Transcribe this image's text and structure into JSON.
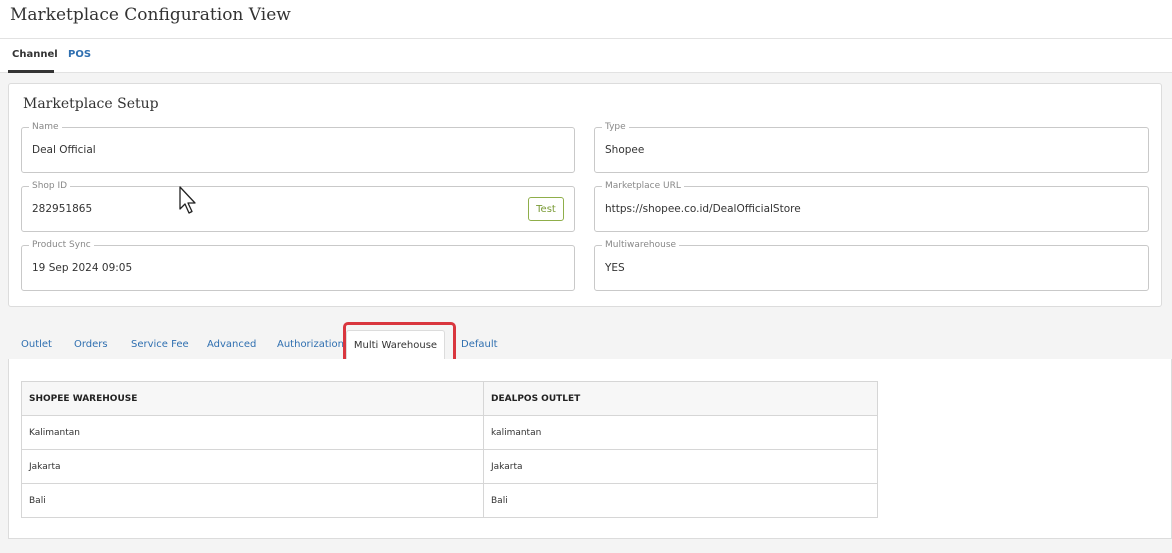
{
  "page": {
    "title": "Marketplace Configuration View"
  },
  "top_tabs": [
    {
      "label": "Channel",
      "active": true
    },
    {
      "label": "POS",
      "active": false
    }
  ],
  "setup": {
    "title": "Marketplace Setup",
    "fields": {
      "name": {
        "label": "Name",
        "value": "Deal Official"
      },
      "type": {
        "label": "Type",
        "value": "Shopee"
      },
      "shop_id": {
        "label": "Shop ID",
        "value": "282951865"
      },
      "marketplace_url": {
        "label": "Marketplace URL",
        "value": "https://shopee.co.id/DealOfficialStore"
      },
      "product_sync": {
        "label": "Product Sync",
        "value": "19 Sep 2024 09:05"
      },
      "multiwarehouse": {
        "label": "Multiwarehouse",
        "value": "YES"
      }
    },
    "test_button_label": "Test"
  },
  "sub_tabs": [
    {
      "label": "Outlet"
    },
    {
      "label": "Orders"
    },
    {
      "label": "Service Fee"
    },
    {
      "label": "Advanced"
    },
    {
      "label": "Authorization"
    },
    {
      "label": "Multi Warehouse",
      "active": true
    },
    {
      "label": "Default"
    }
  ],
  "warehouse_table": {
    "headers": [
      "SHOPEE WAREHOUSE",
      "DEALPOS OUTLET"
    ],
    "rows": [
      [
        "Kalimantan",
        "kalimantan"
      ],
      [
        "Jakarta",
        "Jakarta"
      ],
      [
        "Bali",
        "Bali"
      ]
    ]
  },
  "colors": {
    "link": "#2f6fb0",
    "highlight": "#d9363e",
    "test_button": "#7a9b36"
  }
}
